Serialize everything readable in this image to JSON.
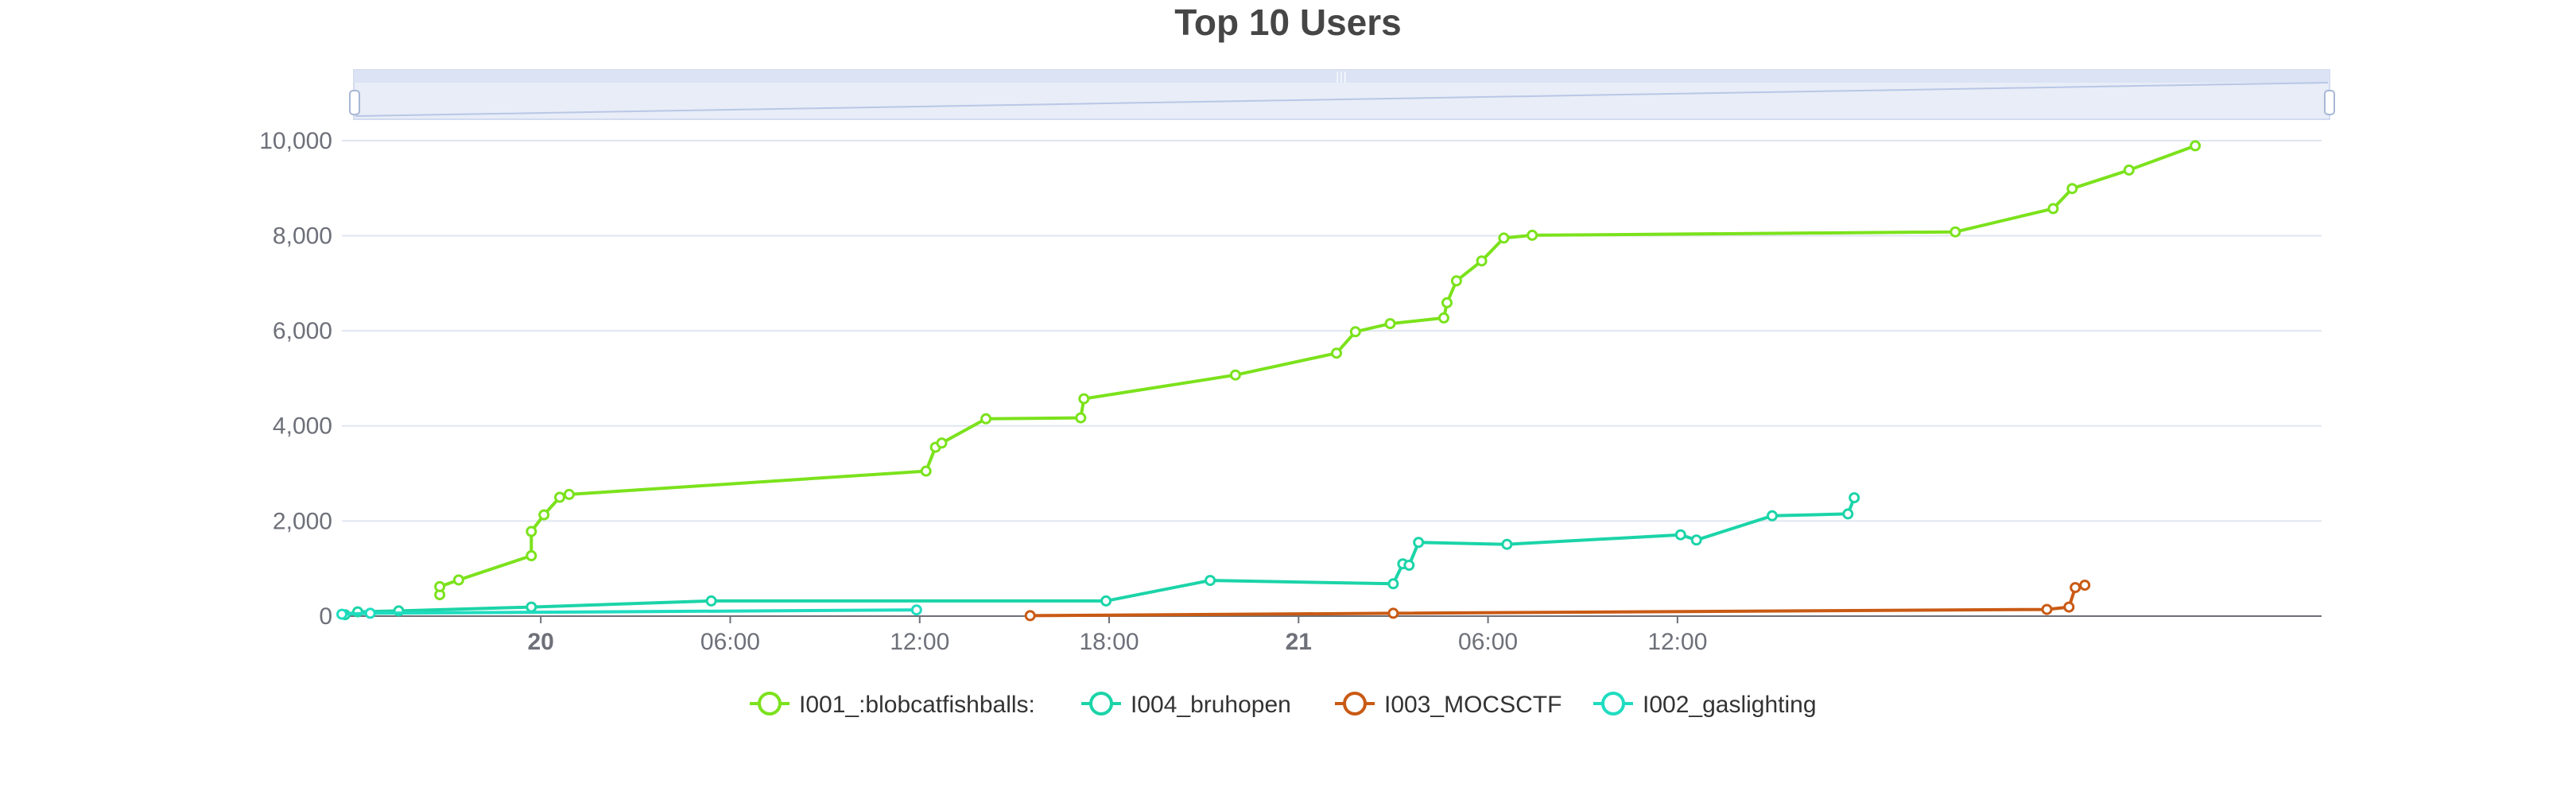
{
  "chart_data": {
    "type": "line",
    "title": "Top 10 Users",
    "xlabel": "",
    "ylabel": "",
    "x_unit": "hours since Day 20 00:00",
    "ylim": [
      0,
      11000
    ],
    "xlim": [
      -6.3,
      56.4
    ],
    "y_ticks": [
      0,
      2000,
      4000,
      6000,
      8000,
      10000
    ],
    "y_tick_labels": [
      "0",
      "2,000",
      "4,000",
      "6,000",
      "8,000",
      "10,000"
    ],
    "x_ticks": [
      0,
      6,
      12,
      18,
      24,
      30,
      36
    ],
    "x_tick_labels": [
      "20",
      "06:00",
      "12:00",
      "18:00",
      "21",
      "06:00",
      "12:00"
    ],
    "x_tick_bold": [
      true,
      false,
      false,
      false,
      true,
      false,
      false
    ],
    "grid": true,
    "legend_position": "bottom-center",
    "has_datazoom_slider": true,
    "series": [
      {
        "name": "I001_:blobcatfishballs:",
        "color": "#7be21c",
        "points": [
          [
            -3.2,
            450
          ],
          [
            -3.2,
            620
          ],
          [
            -2.6,
            760
          ],
          [
            -0.3,
            1270
          ],
          [
            -0.3,
            1780
          ],
          [
            0.1,
            2130
          ],
          [
            0.6,
            2500
          ],
          [
            0.9,
            2560
          ],
          [
            12.2,
            3050
          ],
          [
            12.5,
            3550
          ],
          [
            12.7,
            3640
          ],
          [
            14.1,
            4150
          ],
          [
            17.1,
            4170
          ],
          [
            17.2,
            4570
          ],
          [
            22.0,
            5070
          ],
          [
            25.2,
            5530
          ],
          [
            25.8,
            5980
          ],
          [
            26.9,
            6150
          ],
          [
            28.6,
            6270
          ],
          [
            28.7,
            6590
          ],
          [
            29.0,
            7050
          ],
          [
            29.8,
            7470
          ],
          [
            30.5,
            7950
          ],
          [
            31.4,
            8010
          ],
          [
            44.8,
            8080
          ],
          [
            47.9,
            8570
          ],
          [
            48.5,
            8990
          ],
          [
            50.3,
            9380
          ],
          [
            52.4,
            9890
          ]
        ]
      },
      {
        "name": "I004_bruhopen",
        "color": "#1bd4a8",
        "points": [
          [
            -6.2,
            30
          ],
          [
            -5.8,
            90
          ],
          [
            -4.5,
            110
          ],
          [
            -0.3,
            190
          ],
          [
            5.4,
            320
          ],
          [
            17.9,
            320
          ],
          [
            21.2,
            750
          ],
          [
            27.0,
            680
          ],
          [
            27.3,
            1100
          ],
          [
            27.5,
            1070
          ],
          [
            27.8,
            1550
          ],
          [
            30.6,
            1510
          ],
          [
            36.1,
            1710
          ],
          [
            36.6,
            1600
          ],
          [
            39.0,
            2110
          ],
          [
            41.4,
            2150
          ],
          [
            41.6,
            2490
          ]
        ]
      },
      {
        "name": "I003_MOCSCTF",
        "color": "#c95a14",
        "points": [
          [
            15.5,
            10
          ],
          [
            27.0,
            60
          ],
          [
            47.7,
            140
          ],
          [
            48.4,
            190
          ],
          [
            48.6,
            600
          ],
          [
            48.9,
            650
          ]
        ]
      },
      {
        "name": "I002_gaslighting",
        "color": "#1fdcc0",
        "points": [
          [
            -6.3,
            40
          ],
          [
            -5.4,
            60
          ],
          [
            11.9,
            130
          ]
        ]
      }
    ]
  }
}
